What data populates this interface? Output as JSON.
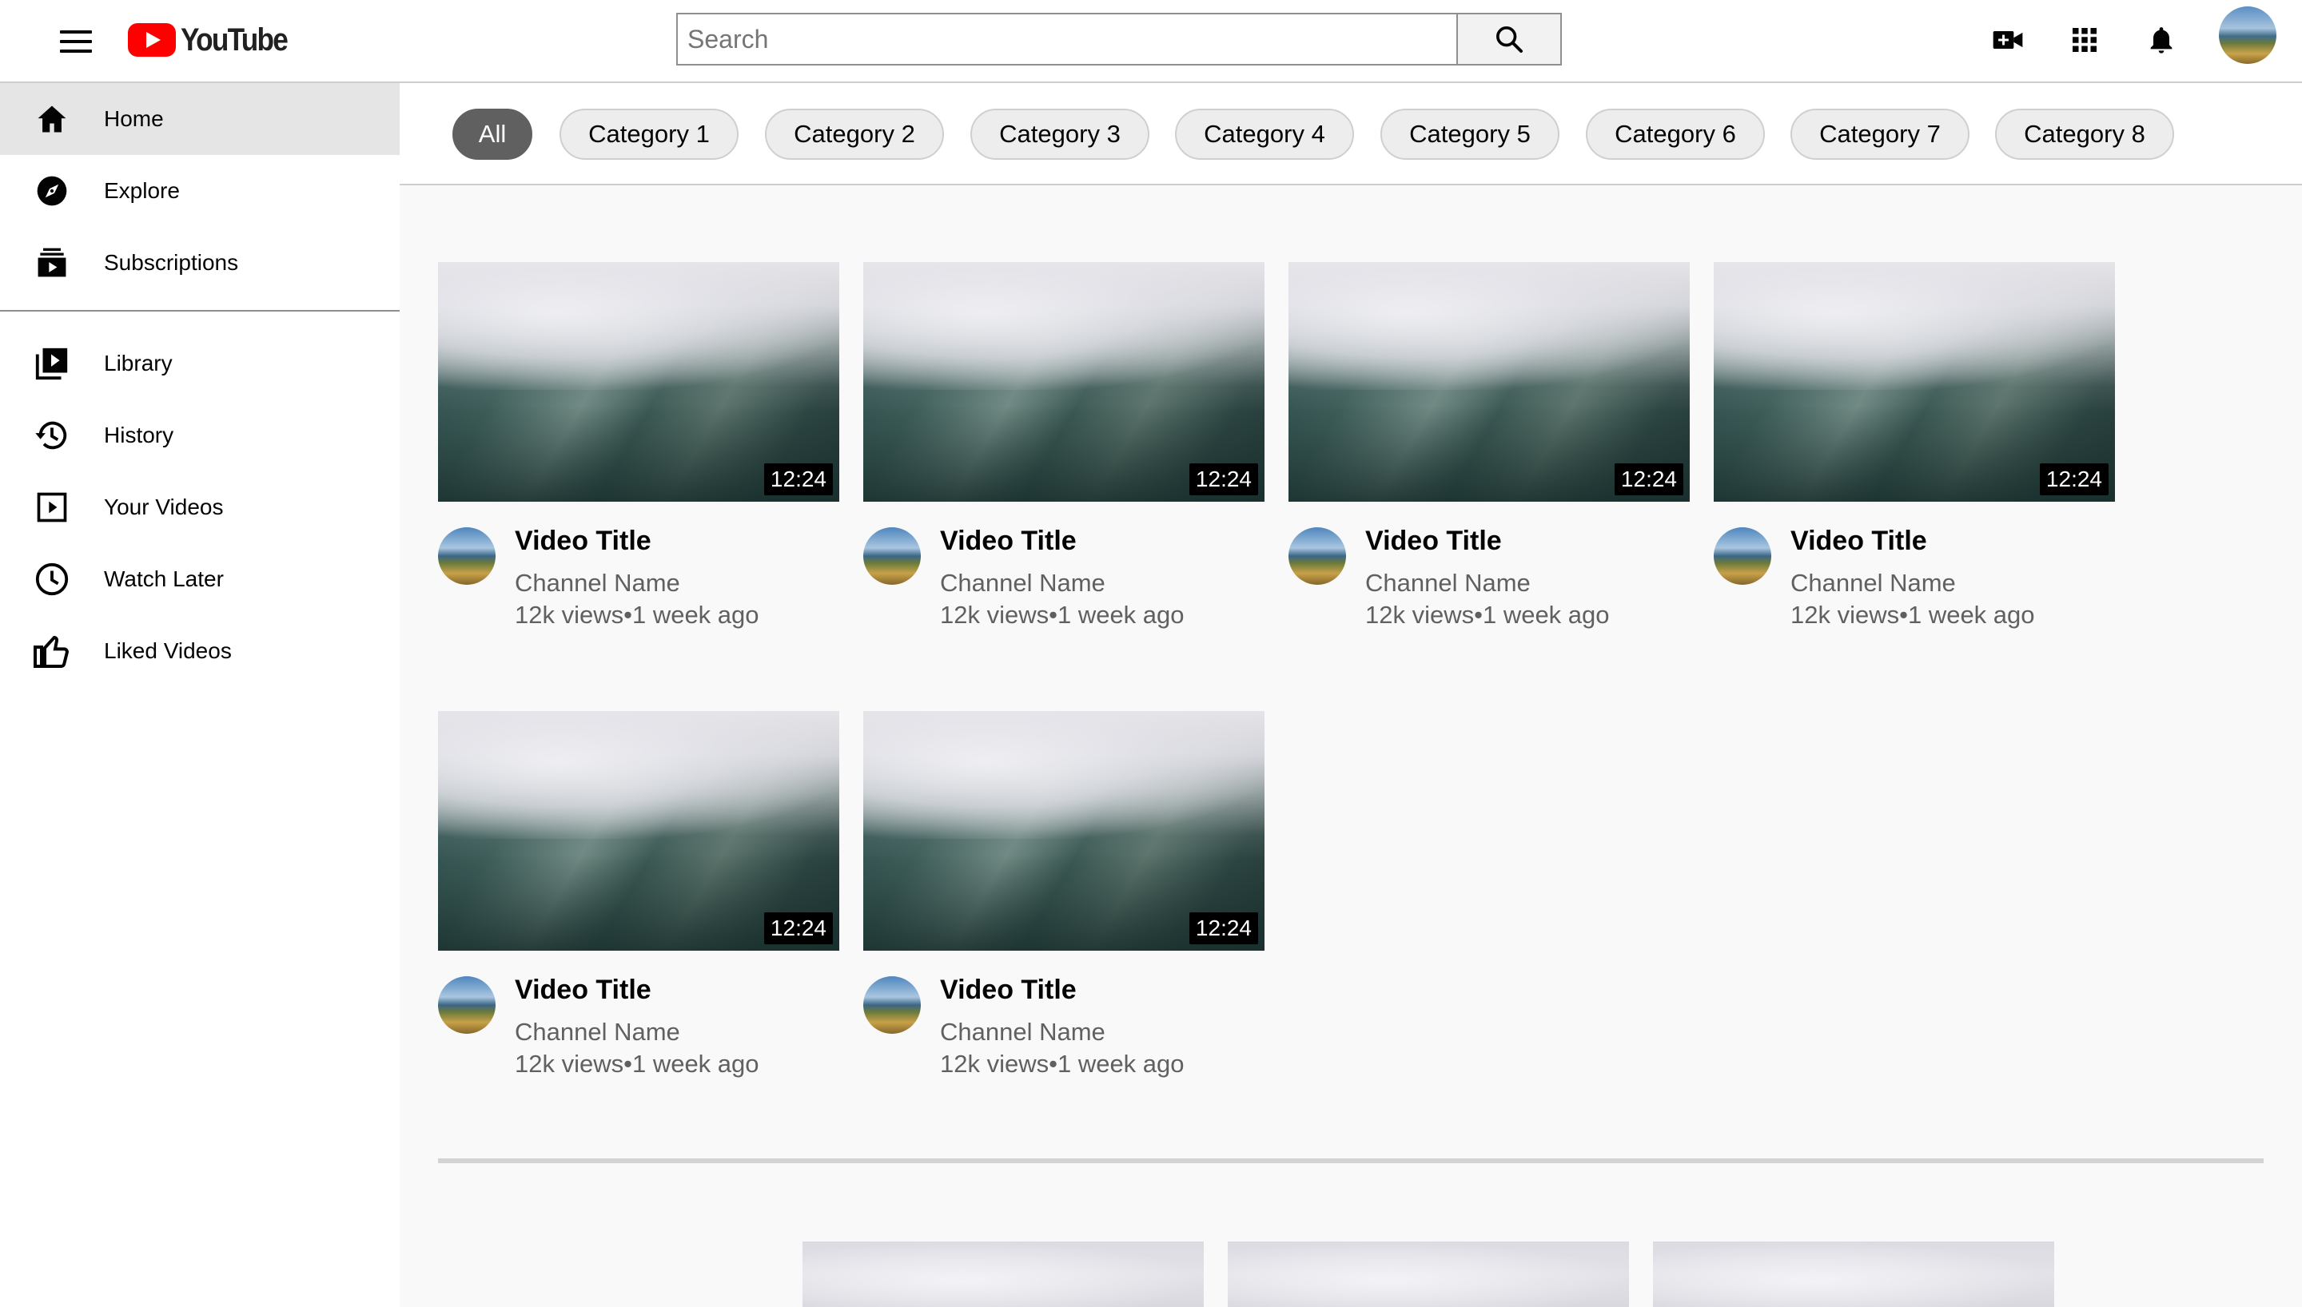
{
  "header": {
    "logo_text": "YouTube",
    "search_placeholder": "Search"
  },
  "sidebar": {
    "items": [
      {
        "label": "Home",
        "icon": "home-icon",
        "active": true
      },
      {
        "label": "Explore",
        "icon": "compass-icon"
      },
      {
        "label": "Subscriptions",
        "icon": "subscriptions-icon"
      },
      {
        "label": "Library",
        "icon": "library-icon"
      },
      {
        "label": "History",
        "icon": "history-icon"
      },
      {
        "label": "Your Videos",
        "icon": "your-videos-icon"
      },
      {
        "label": "Watch Later",
        "icon": "clock-icon"
      },
      {
        "label": "Liked Videos",
        "icon": "thumbs-up-icon"
      }
    ]
  },
  "chips": [
    "All",
    "Category 1",
    "Category 2",
    "Category 3",
    "Category 4",
    "Category 5",
    "Category 6",
    "Category 7",
    "Category 8"
  ],
  "videos": [
    {
      "title": "Video Title",
      "channel": "Channel Name",
      "stats": "12k views•1 week ago",
      "duration": "12:24"
    },
    {
      "title": "Video Title",
      "channel": "Channel Name",
      "stats": "12k views•1 week ago",
      "duration": "12:24"
    },
    {
      "title": "Video Title",
      "channel": "Channel Name",
      "stats": "12k views•1 week ago",
      "duration": "12:24"
    },
    {
      "title": "Video Title",
      "channel": "Channel Name",
      "stats": "12k views•1 week ago",
      "duration": "12:24"
    },
    {
      "title": "Video Title",
      "channel": "Channel Name",
      "stats": "12k views•1 week ago",
      "duration": "12:24"
    },
    {
      "title": "Video Title",
      "channel": "Channel Name",
      "stats": "12k views•1 week ago",
      "duration": "12:24"
    }
  ],
  "colors": {
    "brand_red": "#ff0000",
    "active_chip": "#606060",
    "secondary_text": "#606060"
  }
}
